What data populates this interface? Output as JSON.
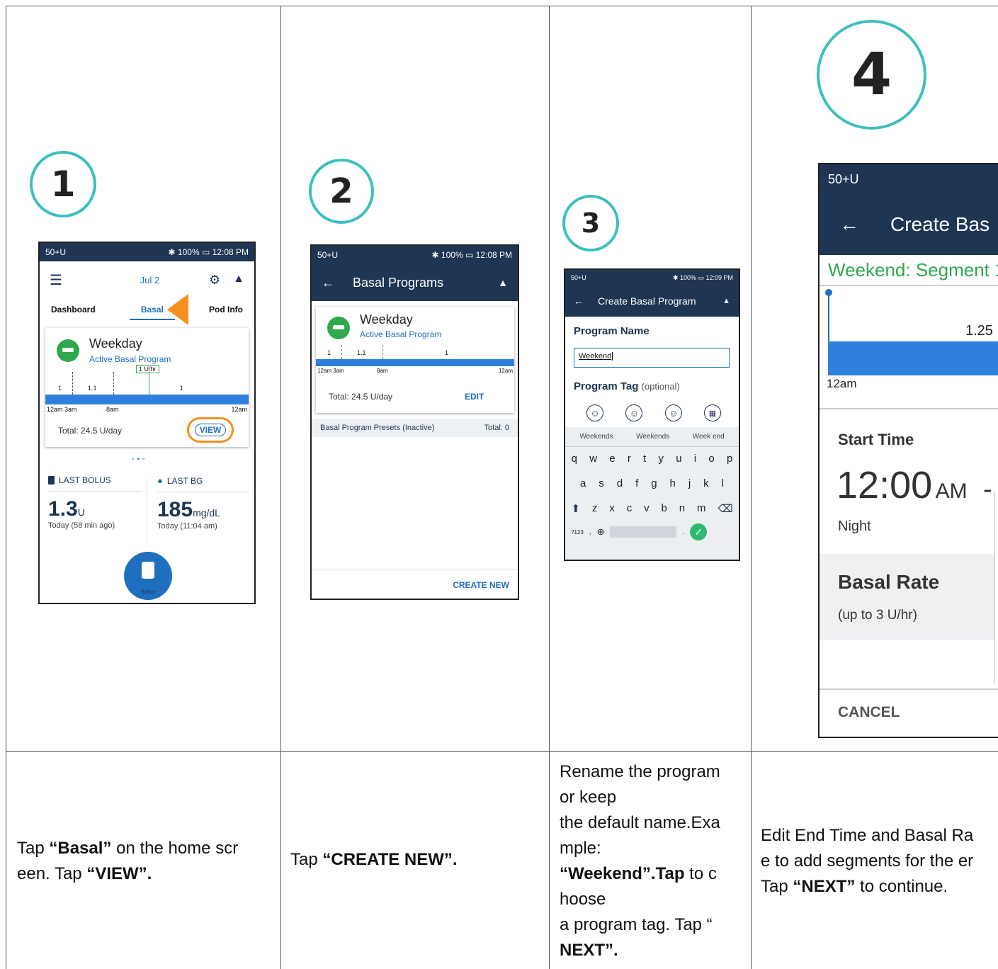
{
  "steps": [
    {
      "number": "1"
    },
    {
      "number": "2"
    },
    {
      "number": "3"
    },
    {
      "number": "4"
    }
  ],
  "instructions": {
    "step1": {
      "t1": "Tap ",
      "b1": "“Basal”",
      "t2": " on the home scr",
      "t3": "een. Tap ",
      "b2": "“VIEW”."
    },
    "step2": {
      "t1": "Tap ",
      "b1": "“CREATE NEW”."
    },
    "step3": {
      "l1": "Rename the program",
      "l2": "or keep",
      "l3": "the default name.Exa",
      "l4": "mple:",
      "b1": "“Weekend”.Tap",
      "t5": " to c",
      "l6": "hoose",
      "l7": "a program tag. Tap “",
      "b2": "NEXT”."
    },
    "step4": {
      "l1": "Edit End Time and Basal Ra",
      "l2": "e to add segments for the er",
      "t3": "Tap ",
      "b1": "“NEXT”",
      "t4": " to continue."
    }
  },
  "screen1": {
    "status_left": "50+U",
    "status_right": "✱ 100% ▭ 12:08 PM",
    "date": "Jul 2",
    "tabs": [
      "Dashboard",
      "Basal",
      "Pod Info"
    ],
    "program_name": "Weekday",
    "program_subtitle": "Active Basal Program",
    "rate_callout": "1 U/hr",
    "rates": [
      "1",
      "1.1",
      "1"
    ],
    "time_labels": [
      "12am 3am",
      "8am",
      "12am"
    ],
    "total": "Total: 24.5 U/day",
    "view_button": "VIEW",
    "last_bolus_label": "LAST BOLUS",
    "last_bolus_value": "1.3",
    "last_bolus_unit": "U",
    "last_bolus_time": "Today (58 min ago)",
    "last_bg_label": "LAST BG",
    "last_bg_value": "185",
    "last_bg_unit": "mg/dL",
    "last_bg_time": "Today (11:04 am)",
    "bolus_label": "Bolus",
    "accent": "#f5901f"
  },
  "screen2": {
    "status_left": "50+U",
    "status_right": "✱ 100% ▭ 12:08 PM",
    "title": "Basal Programs",
    "program_name": "Weekday",
    "program_subtitle": "Active Basal Program",
    "rates": [
      "1",
      "1.1",
      "1"
    ],
    "time_labels": [
      "12am 3am",
      "8am",
      "12am"
    ],
    "total": "Total: 24.5 U/day",
    "edit_button": "EDIT",
    "presets_label": "Basal Program Presets (Inactive)",
    "presets_total": "Total: 0",
    "create_new": "CREATE NEW"
  },
  "screen3": {
    "status_left": "50+U",
    "status_right": "✱ 100% ▭ 12:09 PM",
    "title": "Create Basal Program",
    "name_label": "Program Name",
    "name_value": "Weekend",
    "tag_label": "Program Tag",
    "tag_optional": "(optional)",
    "suggestions": [
      "Weekends",
      "Weekends",
      "Week end"
    ],
    "keys_row1": [
      "q",
      "w",
      "e",
      "r",
      "t",
      "y",
      "u",
      "i",
      "o",
      "p"
    ],
    "keys_row2": [
      "a",
      "s",
      "d",
      "f",
      "g",
      "h",
      "j",
      "k",
      "l"
    ],
    "keys_row3": [
      "z",
      "x",
      "c",
      "v",
      "b",
      "n",
      "m"
    ],
    "key_123": "?123"
  },
  "screen4": {
    "status_left": "50+U",
    "title": "Create Bas",
    "segment": "Weekend: Segment 1",
    "rate": "1.25",
    "time_label": "12am",
    "start_time_label": "Start Time",
    "start_time": "12:00",
    "am": "AM",
    "dash": "-",
    "night": "Night",
    "basal_rate_label": "Basal Rate",
    "basal_rate_hint": "(up to 3 U/hr)",
    "cancel": "CANCEL"
  }
}
